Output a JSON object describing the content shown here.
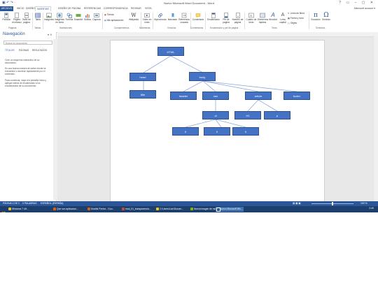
{
  "title_bar": {
    "quick_access": "▣ ↶ ↷ ·",
    "doc_title": "Nuevo Microsoft Word Document - Word",
    "window_controls": "? ▭ – ▢ ✕"
  },
  "tabs": [
    "ARCHIVO",
    "INICIO",
    "DISEÑO",
    "INSERTAR",
    "DISEÑO DE PÁGINA",
    "REFERENCIAS",
    "CORRESPONDENCIA",
    "REVISAR",
    "VISTA"
  ],
  "active_tab": "INSERTAR",
  "user": "Microsoft account ▾",
  "ribbon": {
    "buttons": [
      "Portada",
      "Página en blanco",
      "Salto de página",
      "Tabla",
      "Imágenes",
      "Imágenes en línea",
      "Formas",
      "SmartArt",
      "Gráfico",
      "Captura",
      "Tienda",
      "Mis aplicaciones",
      "Wikipedia",
      "Vídeo en línea",
      "Hipervínculo",
      "Marcador",
      "Referencia cruzada",
      "Comentario",
      "Encabezado",
      "Pie de página",
      "Número de página",
      "Cuadro de texto",
      "Elementos rápidos",
      "WordArt",
      "Letra capital",
      "Línea de firma",
      "Fecha y hora",
      "Objeto",
      "Ecuación",
      "Símbolo"
    ],
    "groups": [
      "Páginas",
      "Tablas",
      "Ilustraciones",
      "Complementos",
      "Multimedia",
      "Vínculos",
      "Comentarios",
      "Encabezado y pie de página",
      "Texto",
      "Símbolos"
    ]
  },
  "nav": {
    "title": "Navegación",
    "close": "▾ ✕",
    "search_placeholder": "Buscar en documento",
    "tabs": [
      "TÍTULOS",
      "PÁGINAS",
      "RESULTADOS"
    ],
    "p1": "Cree un esquema interactivo de su documento.",
    "p2": "Es una buena manera de saber dónde se encuentra o moverse rápidamente por el contenido.",
    "p3": "Para comenzar, vaya a la pestaña Inicio y aplique estilos de encabezado a los encabezados de su documento."
  },
  "diagram": {
    "html": "HTML",
    "head": "head",
    "body": "body",
    "title": "title",
    "header": "header",
    "nav": "nav",
    "article": "article",
    "footer": "footer",
    "ul": "ul",
    "h1": "H1",
    "p": "p",
    "li1": "li",
    "li2": "li",
    "li3": "li"
  },
  "status": {
    "page": "PÁGINA 1 DE 1",
    "words": "0 PALABRAS",
    "lang": "ESPAÑOL (ESPAÑA)",
    "zoom": "100 %"
  },
  "taskbar": {
    "items": [
      "Windows 7 Ult...",
      "Que son aplicacion...",
      "Mozilla Firefox - Goo...",
      "mod_01_transparencia...",
      "C:\\Users\\Luiz\\Docum...",
      "Nueva imagen de ma...",
      "Nuevo Microsoft Wo..."
    ],
    "clock": "2:40"
  },
  "colors": {
    "accent": "#2b579a",
    "node_fill": "#4472c4",
    "node_border": "#2f528f",
    "taskbar": "#1c3f6e"
  }
}
